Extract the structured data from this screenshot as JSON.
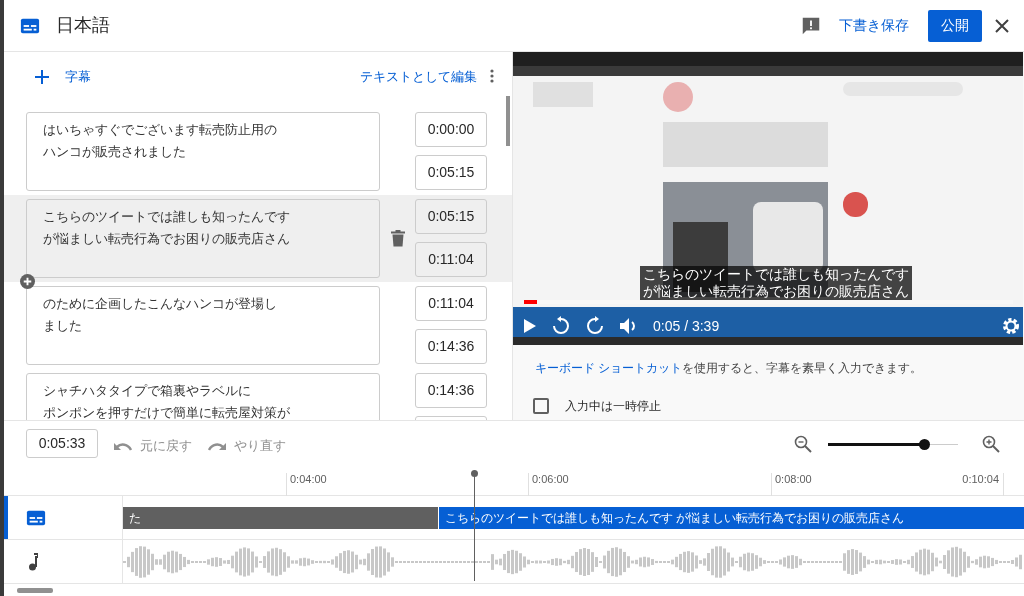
{
  "dialog": {
    "title": "日本語",
    "draft": "下書き保存",
    "publish": "公開"
  },
  "editor": {
    "add_label": "字幕",
    "edit_as_text": "テキストとして編集",
    "captions": [
      {
        "lines": [
          "はいちゃすぐでございます転売防止用の",
          "ハンコが販売されました"
        ],
        "start": "0:00:00",
        "end": "0:05:15",
        "selected": false
      },
      {
        "lines": [
          "こちらのツイートでは誰しも知ったんです",
          "が悩ましい転売行為でお困りの販売店さん"
        ],
        "start": "0:05:15",
        "end": "0:11:04",
        "selected": true
      },
      {
        "lines": [
          "のために企画したこんなハンコが登場し",
          "ました"
        ],
        "start": "0:11:04",
        "end": "0:14:36",
        "selected": false
      },
      {
        "lines": [
          "シャチハタタイプで箱裏やラベルに",
          "ポンポンを押すだけで簡単に転売屋対策が"
        ],
        "start": "0:14:36",
        "selected": false
      }
    ]
  },
  "player": {
    "caption_lines": [
      "こちらのツイートでは誰しも知ったんです",
      "が悩ましい転売行為でお困りの販売店さん"
    ],
    "time": "0:05 / 3:39",
    "progress": {
      "level": 0.027
    }
  },
  "hint": {
    "link": "キーボード ショートカット",
    "text": "を使用すると、字幕を素早く入力できます。"
  },
  "pause_while_typing": {
    "label": "入力中は一時停止",
    "checked": false
  },
  "timeline": {
    "current_time": "0:05:33",
    "undo": {
      "label": "元に戻す",
      "disabled": true
    },
    "redo": {
      "label": "やり直す",
      "disabled": true
    },
    "zoom": {
      "level": 0.74
    },
    "ruler": [
      "0:04:00",
      "0:06:00",
      "0:08:00",
      "0:10:04"
    ],
    "segments": [
      {
        "text": "た",
        "selected": false
      },
      {
        "text": "こちらのツイートでは誰しも知ったんです が悩ましい転売行為でお困りの販売店さん",
        "selected": true
      }
    ]
  }
}
